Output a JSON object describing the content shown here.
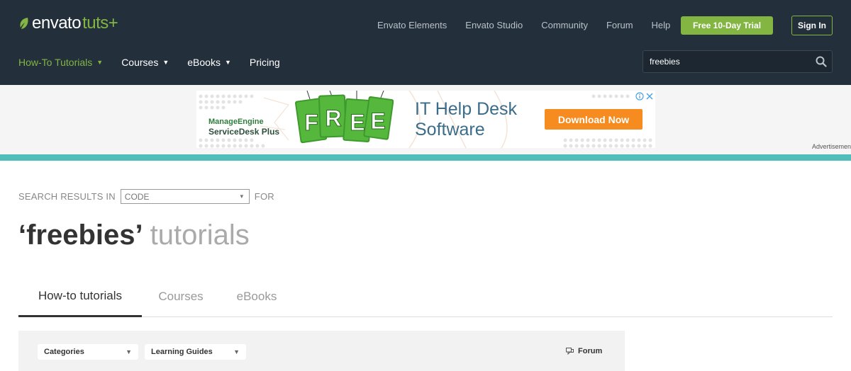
{
  "brand": {
    "name": "envato",
    "sub": "tuts+"
  },
  "topnav": [
    "Envato Elements",
    "Envato Studio",
    "Community",
    "Forum",
    "Help"
  ],
  "trial_label": "Free 10-Day Trial",
  "signin_label": "Sign In",
  "mainnav": [
    {
      "label": "How-To Tutorials",
      "active": true,
      "has_menu": true
    },
    {
      "label": "Courses",
      "active": false,
      "has_menu": true
    },
    {
      "label": "eBooks",
      "active": false,
      "has_menu": true
    },
    {
      "label": "Pricing",
      "active": false,
      "has_menu": false
    }
  ],
  "search": {
    "value": "freebies"
  },
  "ad": {
    "brand_line1": "ManageEngine",
    "brand_line2": "ServiceDesk Plus",
    "free_letters": [
      "F",
      "R",
      "E",
      "E"
    ],
    "headline1": "IT Help Desk",
    "headline2": "Software",
    "cta": "Download Now",
    "label": "Advertisement"
  },
  "results": {
    "prefix": "SEARCH RESULTS IN",
    "scope": "CODE",
    "suffix": "FOR",
    "query": "‘freebies’",
    "noun": "tutorials"
  },
  "tabs": [
    {
      "label": "How-to tutorials",
      "active": true
    },
    {
      "label": "Courses",
      "active": false
    },
    {
      "label": "eBooks",
      "active": false
    }
  ],
  "filters": {
    "categories": "Categories",
    "guides": "Learning Guides",
    "forum": "Forum"
  },
  "colors": {
    "header_bg": "#232f3b",
    "accent_green": "#82b541",
    "teal_bar": "#4fbdba",
    "cta_orange": "#f68b1f"
  }
}
